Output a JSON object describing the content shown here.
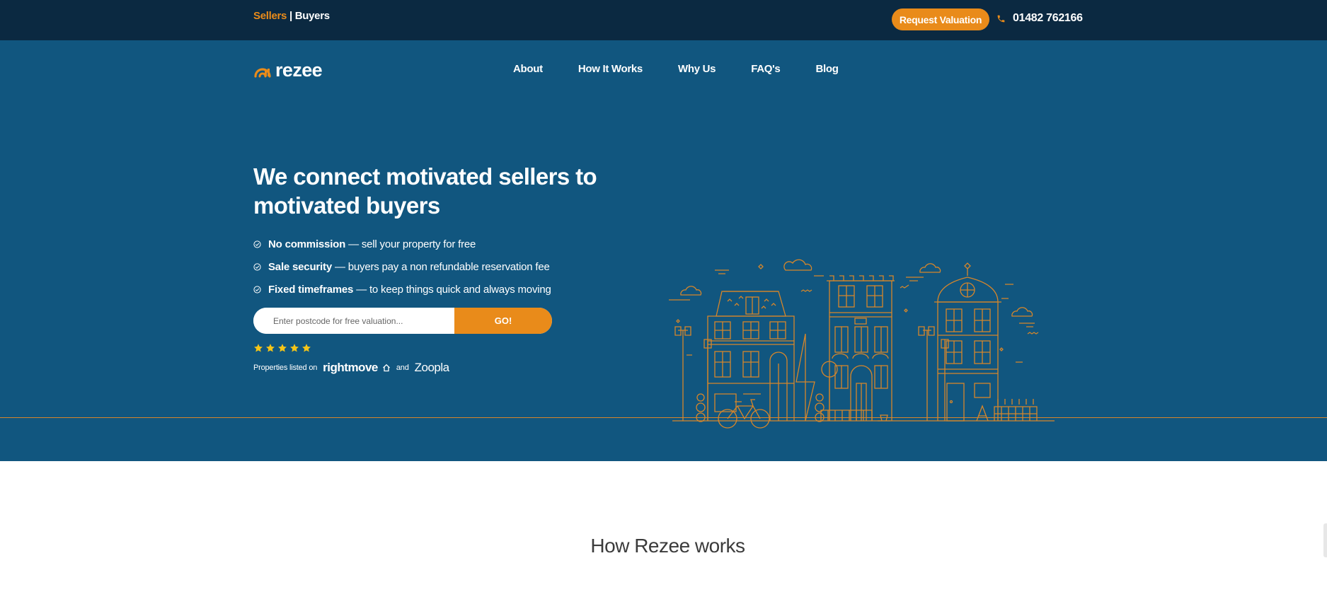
{
  "topbar": {
    "audience_sellers": "Sellers",
    "audience_separator": " | ",
    "audience_buyers": "Buyers",
    "request_valuation_label": "Request Valuation",
    "phone_number": "01482 762166"
  },
  "header": {
    "logo_text": "rezee",
    "nav": [
      "About",
      "How It Works",
      "Why Us",
      "FAQ's",
      "Blog"
    ]
  },
  "hero": {
    "headline": "We connect motivated sellers to motivated buyers",
    "features": [
      {
        "bold": "No commission",
        "text": "— sell your property for free"
      },
      {
        "bold": "Sale security",
        "text": "— buyers pay a non refundable reservation fee"
      },
      {
        "bold": "Fixed timeframes",
        "text": "— to keep things quick and always moving"
      }
    ],
    "search_placeholder": "Enter postcode for free valuation...",
    "search_button": "GO!",
    "rating_stars": 5,
    "listed_prefix": "Properties listed on",
    "listed_brand_1": "rightmove",
    "listed_and": "and",
    "listed_brand_2": "Zoopla"
  },
  "section": {
    "title": "How Rezee works"
  },
  "colors": {
    "accent": "#e98b1a",
    "topbar_bg": "#0b2941",
    "hero_bg": "#11567f",
    "star": "#f5c518"
  },
  "icons": [
    "phone-icon",
    "logo-icon",
    "check-circle-icon",
    "star-icon",
    "rightmove-house-icon",
    "houses-illustration"
  ]
}
